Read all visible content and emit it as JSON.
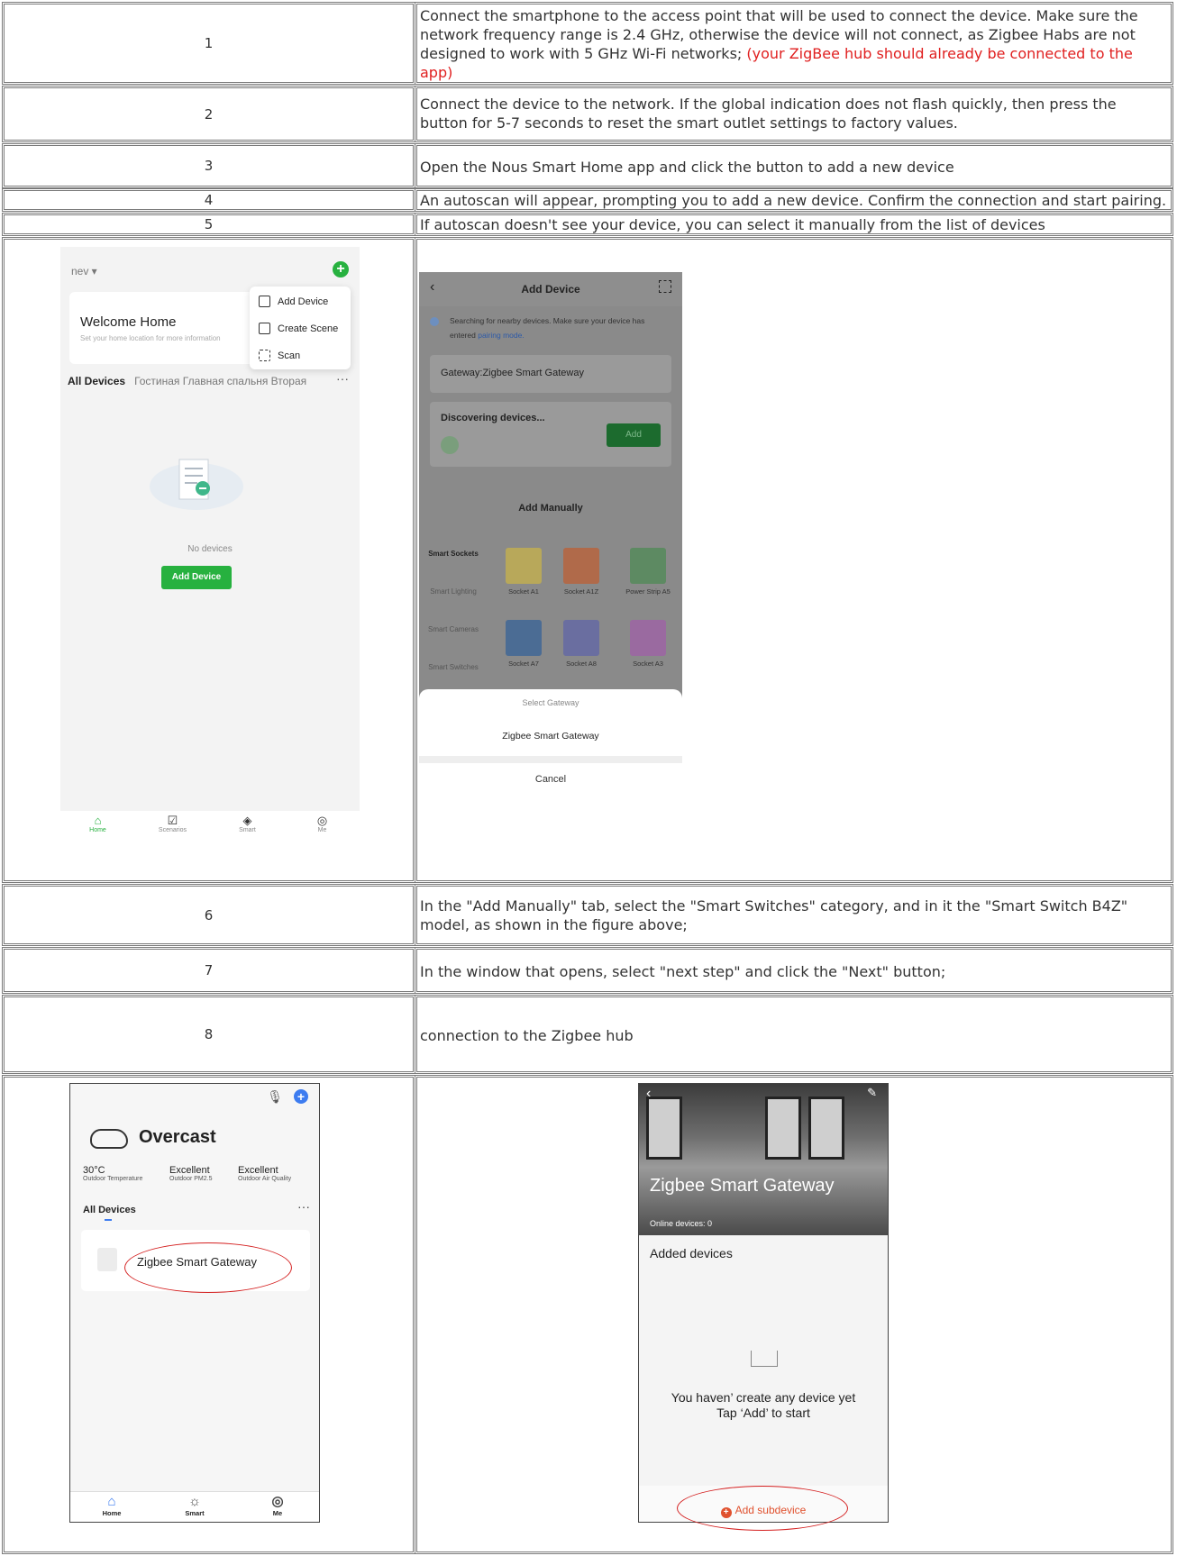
{
  "rows": [
    {
      "num": "1",
      "text": "Connect the smartphone to the access point that will be used to connect the device. Make sure the network frequency range is 2.4 GHz, otherwise the device will not connect, as Zigbee Habs are not designed to work with 5 GHz Wi-Fi networks;",
      "text_red": "(your ZigBee hub should already be connected to the app)"
    },
    {
      "num": "2",
      "text": "Connect the device to the network. If the global indication does not flash quickly, then press the button for 5-7 seconds to reset the smart  outlet settings to factory values."
    },
    {
      "num": "3",
      "text": "Open the Nous Smart Home app and click the button to add a new device"
    },
    {
      "num": "4",
      "text": "An autoscan will appear, prompting you to add a new device. Confirm the connection and start pairing."
    },
    {
      "num": "5",
      "text": "If autoscan doesn't see your device, you can select it manually from the list of devices"
    },
    {
      "num": "6",
      "text": "In the \"Add Manually\" tab, select the \"Smart Switches\" category, and in it the \"Smart Switch B4Z\" model, as shown in the figure above;"
    },
    {
      "num": "7",
      "text": "In the window that opens, select \"next step\" and click the \"Next\" button;"
    },
    {
      "num": "8",
      "text": "connection to the Zigbee hub"
    }
  ],
  "shot_home": {
    "home_name": "nev ▾",
    "welcome_title": "Welcome Home",
    "welcome_sub": "Set your home location for more information",
    "menu": [
      "Add Device",
      "Create Scene",
      "Scan"
    ],
    "tabs_active": "All Devices",
    "tabs_rest": "Гостиная   Главная спальня   Вторая",
    "no_devices": "No devices",
    "add_button": "Add Device",
    "tabbar": [
      "Home",
      "Scenarios",
      "Smart",
      "Me"
    ]
  },
  "shot_add": {
    "title": "Add Device",
    "search_text": "Searching for nearby devices. Make sure your device has entered",
    "search_link": "pairing mode.",
    "gateway": "Gateway:Zigbee Smart Gateway",
    "discovering": "Discovering devices...",
    "add": "Add",
    "manual": "Add Manually",
    "categories": [
      "Smart Sockets",
      "Smart Lighting",
      "Smart Cameras",
      "Smart Switches"
    ],
    "products": [
      "Socket A1",
      "Socket A1Z",
      "Power Strip A5",
      "Socket A7",
      "Socket A8",
      "Socket A3"
    ],
    "product_colors": [
      "#b8a85a",
      "#b06a4a",
      "#5d8a62",
      "#4b6c94",
      "#6a6ea0",
      "#9a6aa0"
    ],
    "sheet_title": "Select Gateway",
    "sheet_option": "Zigbee Smart Gateway",
    "cancel": "Cancel"
  },
  "shot_overcast": {
    "weather": "Overcast",
    "stats": [
      {
        "value": "30°C",
        "label": "Outdoor Temperature"
      },
      {
        "value": "Excellent",
        "label": "Outdoor PM2.5"
      },
      {
        "value": "Excellent",
        "label": "Outdoor Air Quality"
      }
    ],
    "all_devices": "All Devices",
    "device": "Zigbee Smart Gateway",
    "tabbar": [
      "Home",
      "Smart",
      "Me"
    ],
    "accent": "#3d7cf0"
  },
  "shot_gateway": {
    "name": "Zigbee Smart Gateway",
    "online": "Online devices: 0",
    "added": "Added devices",
    "empty_line1": "You haven’ create any device yet",
    "empty_line2": "Tap ‘Add’ to start",
    "add_sub": "Add subdevice",
    "highlight": "#d42020"
  }
}
